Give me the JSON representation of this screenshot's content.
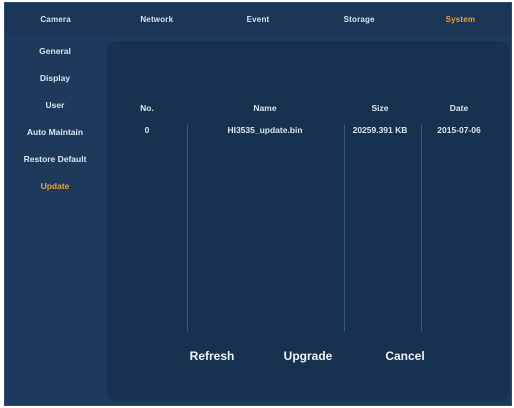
{
  "tabs": [
    "Camera",
    "Network",
    "Event",
    "Storage",
    "System"
  ],
  "active_tab": "System",
  "sidebar": {
    "items": [
      "General",
      "Display",
      "User",
      "Auto Maintain",
      "Restore Default",
      "Update"
    ],
    "active": "Update"
  },
  "table": {
    "headers": {
      "no": "No.",
      "name": "Name",
      "size": "Size",
      "date": "Date"
    },
    "rows": [
      {
        "no": "0",
        "name": "HI3535_update.bin",
        "size": "20259.391 KB",
        "date": "2015-07-06"
      }
    ]
  },
  "buttons": {
    "refresh": "Refresh",
    "upgrade": "Upgrade",
    "cancel": "Cancel"
  },
  "colors": {
    "background": "#1d3a5c",
    "panel": "#17324f",
    "accent": "#e8a23a"
  }
}
